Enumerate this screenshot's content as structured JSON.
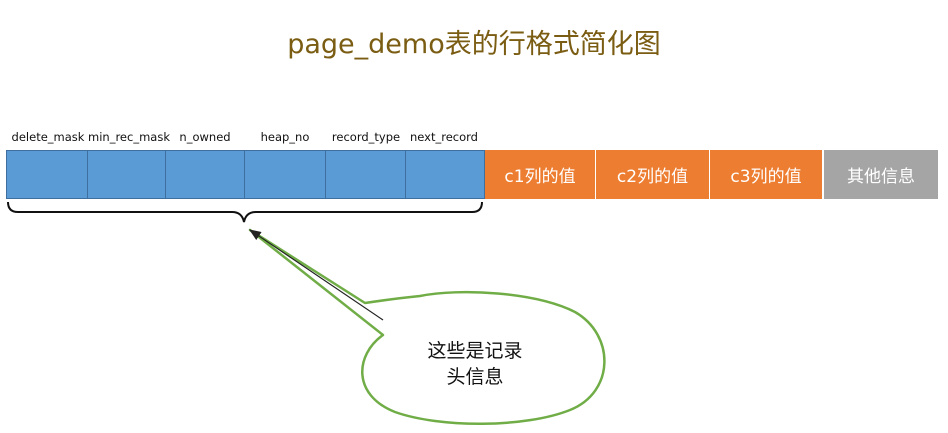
{
  "title": "page_demo表的行格式简化图",
  "header_fields": [
    "delete_mask",
    "min_rec_mask",
    "n_owned",
    "heap_no",
    "record_type",
    "next_record"
  ],
  "data_cells": [
    {
      "label": "c1列的值",
      "color": "#ed7d31"
    },
    {
      "label": "c2列的值",
      "color": "#ed7d31"
    },
    {
      "label": "c3列的值",
      "color": "#ed7d31"
    },
    {
      "label": "其他信息",
      "color": "#a5a5a5"
    }
  ],
  "callout": {
    "line1": "这些是记录",
    "line2": "头信息",
    "fill": "#ffffff",
    "border": "#70ad47"
  },
  "colors": {
    "header_cells": "#5b9bd5",
    "title": "#7a5c12"
  }
}
